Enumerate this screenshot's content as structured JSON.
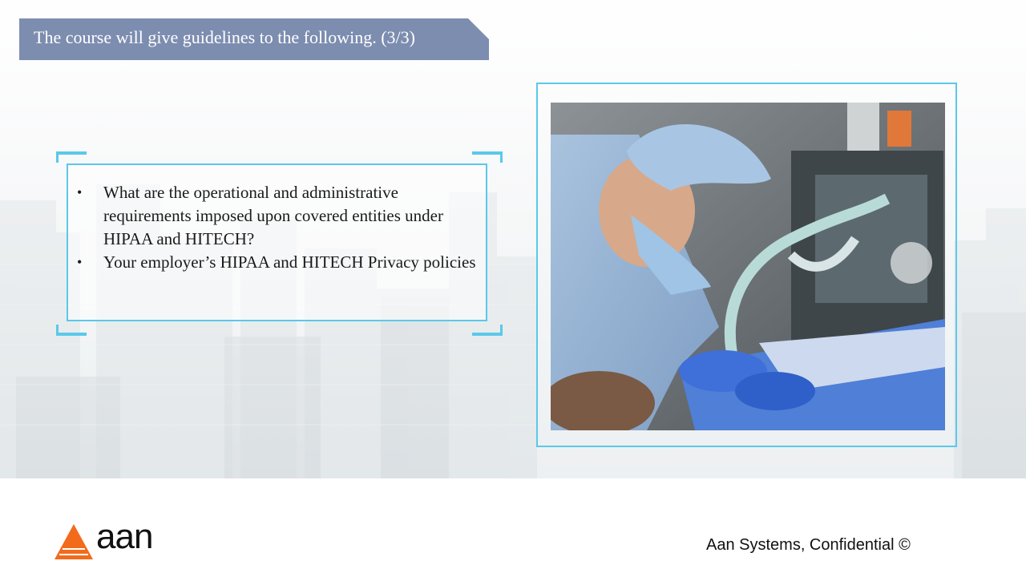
{
  "slide": {
    "title": "The course will give guidelines to the following. (3/3)",
    "bullets": [
      {
        "marker": "•",
        "text": "What are the operational and administrative requirements imposed upon covered entities under HIPAA and HITECH?"
      },
      {
        "marker": "•",
        "text": "Your employer’s HIPAA and HITECH Privacy policies"
      }
    ],
    "image": {
      "subject": "surgeon-in-operating-room"
    }
  },
  "footer": {
    "logo_text": "aan",
    "confidential": "Aan Systems, Confidential ©"
  },
  "colors": {
    "banner": "#7d8db0",
    "frame_accent": "#5bc8ea",
    "logo_orange": "#f26b1d"
  }
}
